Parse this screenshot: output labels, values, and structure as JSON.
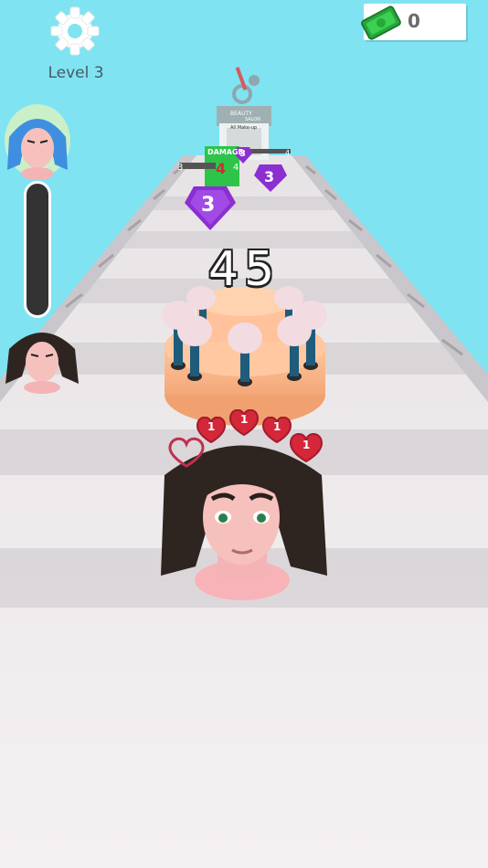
{
  "hud": {
    "level_label": "Level 3",
    "money_value": "0",
    "score": "45",
    "icons": [
      "gear-icon",
      "money-bill-icon"
    ]
  },
  "track": {
    "gems": [
      {
        "value": "3",
        "color": "#8b2fd1"
      },
      {
        "value": "3",
        "color": "#8b2fd1"
      },
      {
        "value": "3",
        "color": "#8b2fd1"
      }
    ],
    "gates": [
      {
        "left_value": "3",
        "right_value": "4",
        "label": "DAMAGE"
      },
      {
        "right_value": "4"
      }
    ],
    "power_value": "4",
    "finish_sign": {
      "title": "BEAUTY",
      "subtitle": "SALON",
      "menu": "All Make-up"
    }
  },
  "hearts": [
    "1",
    "1",
    "1",
    "1"
  ],
  "colors": {
    "sky": "#7fe3f2",
    "road": "#f1eeef",
    "gem": "#8b2fd1",
    "money": "#2fcf43"
  }
}
